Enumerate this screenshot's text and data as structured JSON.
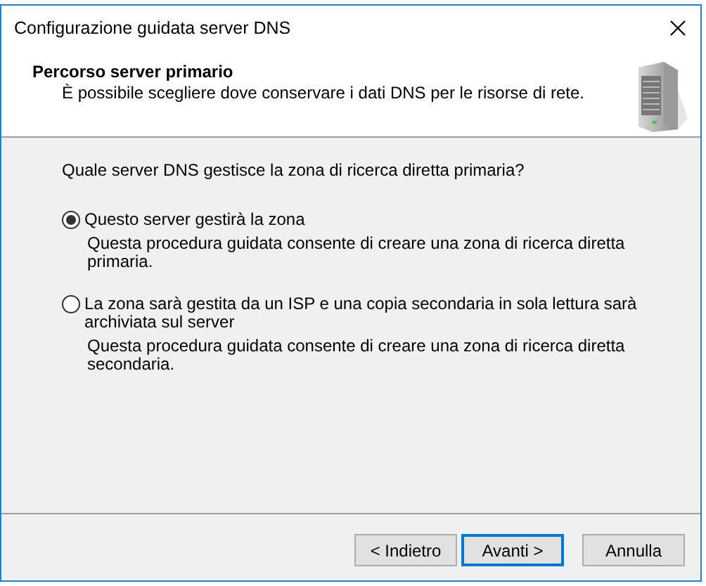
{
  "window": {
    "title": "Configurazione guidata server DNS"
  },
  "header": {
    "title": "Percorso server primario",
    "subtitle": "È possibile scegliere dove conservare i dati DNS per le risorse di rete."
  },
  "question": "Quale server DNS gestisce la zona di ricerca diretta primaria?",
  "options": [
    {
      "label": "Questo server gestirà la zona",
      "description": "Questa procedura guidata consente di creare una zona di ricerca diretta primaria.",
      "selected": true
    },
    {
      "label": "La zona sarà gestita da un ISP e una copia secondaria in sola lettura sarà archiviata sul server",
      "description": "Questa procedura guidata consente di creare una zona di ricerca diretta secondaria.",
      "selected": false
    }
  ],
  "buttons": [
    {
      "label": "< Indietro",
      "focused": false
    },
    {
      "label": "Avanti >",
      "focused": true
    },
    {
      "label": "Annulla",
      "focused": false
    }
  ]
}
